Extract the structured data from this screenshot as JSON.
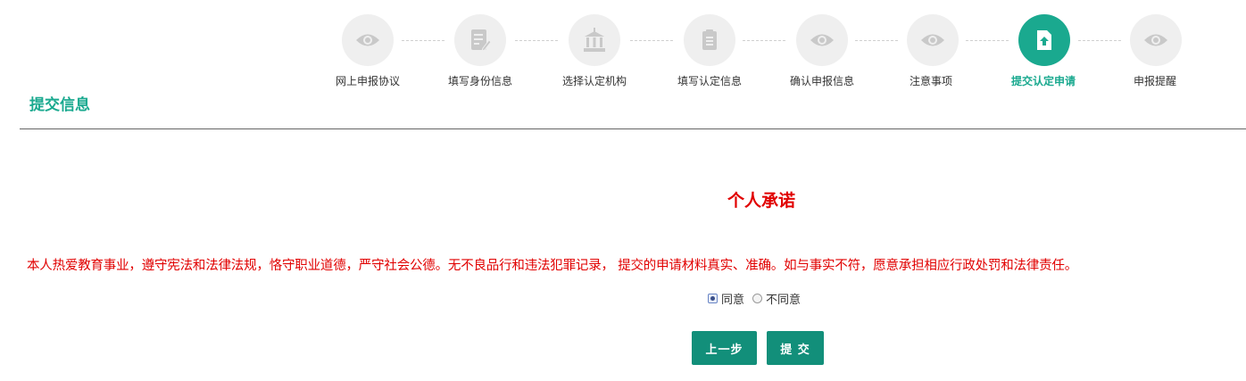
{
  "page": {
    "title": "提交信息"
  },
  "steps": [
    {
      "label": "网上申报协议",
      "icon": "eye-icon",
      "active": false
    },
    {
      "label": "填写身份信息",
      "icon": "edit-document-icon",
      "active": false
    },
    {
      "label": "选择认定机构",
      "icon": "institution-building-icon",
      "active": false
    },
    {
      "label": "填写认定信息",
      "icon": "document-list-icon",
      "active": false
    },
    {
      "label": "确认申报信息",
      "icon": "eye-icon",
      "active": false
    },
    {
      "label": "注意事项",
      "icon": "eye-icon",
      "active": false
    },
    {
      "label": "提交认定申请",
      "icon": "upload-file-icon",
      "active": true
    },
    {
      "label": "申报提醒",
      "icon": "eye-icon",
      "active": false
    }
  ],
  "pledge": {
    "title": "个人承诺",
    "text": "本人热爱教育事业，遵守宪法和法律法规，恪守职业道德，严守社会公德。无不良品行和违法犯罪记录， 提交的申请材料真实、准确。如与事实不符，愿意承担相应行政处罚和法律责任。"
  },
  "agreement": {
    "options": [
      {
        "label": "同意",
        "selected": true
      },
      {
        "label": "不同意",
        "selected": false
      }
    ]
  },
  "buttons": {
    "prev_label": "上一步",
    "submit_label": "提 交"
  },
  "colors": {
    "accent": "#1aa98f",
    "button": "#128f7a",
    "warning_text": "#e10000",
    "inactive_circle": "#efefef"
  }
}
